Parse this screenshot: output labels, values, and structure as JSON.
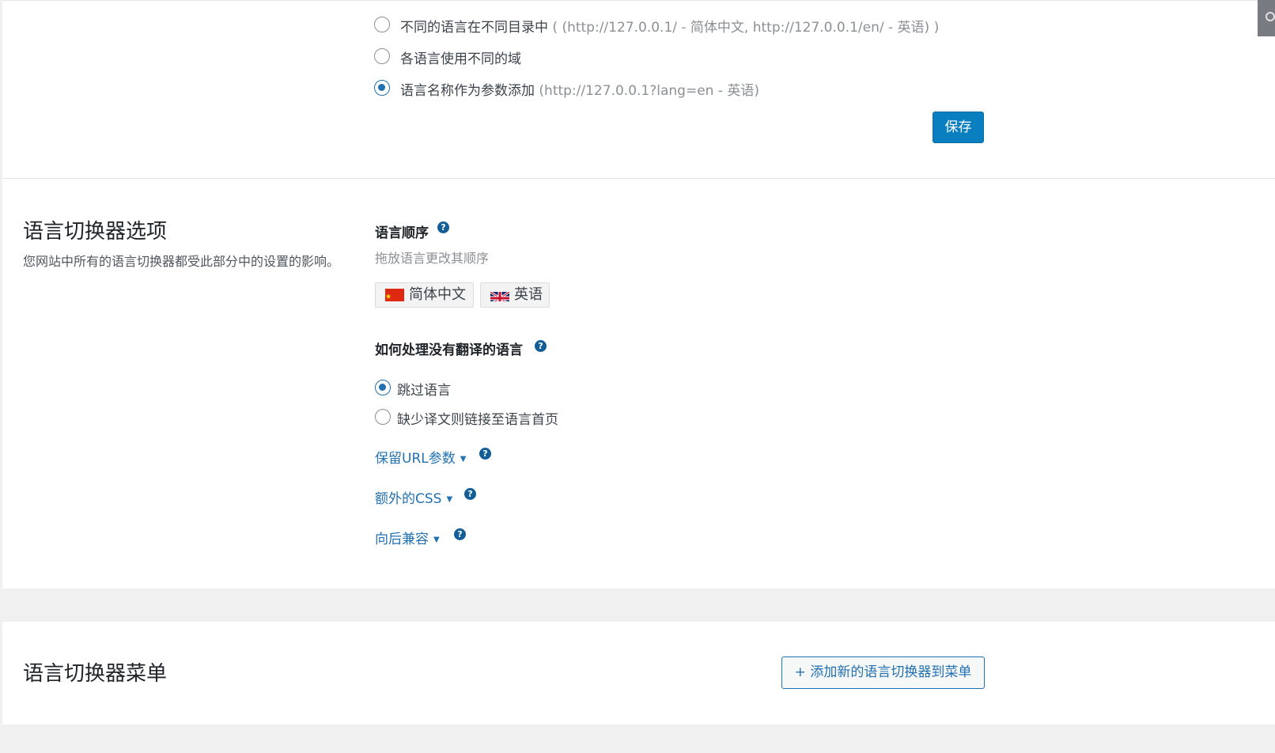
{
  "url_mode": {
    "options": [
      {
        "label": "不同的语言在不同目录中",
        "hint": "( (http://127.0.0.1/ - 简体中文, http://127.0.0.1/en/ - 英语) )",
        "checked": false
      },
      {
        "label": "各语言使用不同的域",
        "hint": "",
        "checked": false
      },
      {
        "label": "语言名称作为参数添加",
        "hint": "(http://127.0.0.1?lang=en - 英语)",
        "checked": true
      }
    ],
    "save_label": "保存"
  },
  "switcher_options": {
    "title": "语言切换器选项",
    "description": "您网站中所有的语言切换器都受此部分中的设置的影响。",
    "language_order": {
      "label": "语言顺序",
      "hint": "拖放语言更改其顺序",
      "languages": [
        {
          "name": "简体中文",
          "flag": "cn-flag-icon"
        },
        {
          "name": "英语",
          "flag": "gb-flag-icon"
        }
      ]
    },
    "untranslated": {
      "label": "如何处理没有翻译的语言",
      "options": [
        {
          "label": "跳过语言",
          "checked": true
        },
        {
          "label": "缺少译文则链接至语言首页",
          "checked": false
        }
      ]
    },
    "collapsibles": [
      {
        "label": "保留URL参数"
      },
      {
        "label": "额外的CSS"
      },
      {
        "label": "向后兼容"
      }
    ],
    "help_glyph": "?",
    "caret_glyph": "▼"
  },
  "switcher_menu": {
    "title": "语言切换器菜单",
    "add_button_label": "+ 添加新的语言切换器到菜单"
  },
  "colors": {
    "primary": "#0a7fbf",
    "link": "#2271b1",
    "help": "#135e96"
  }
}
